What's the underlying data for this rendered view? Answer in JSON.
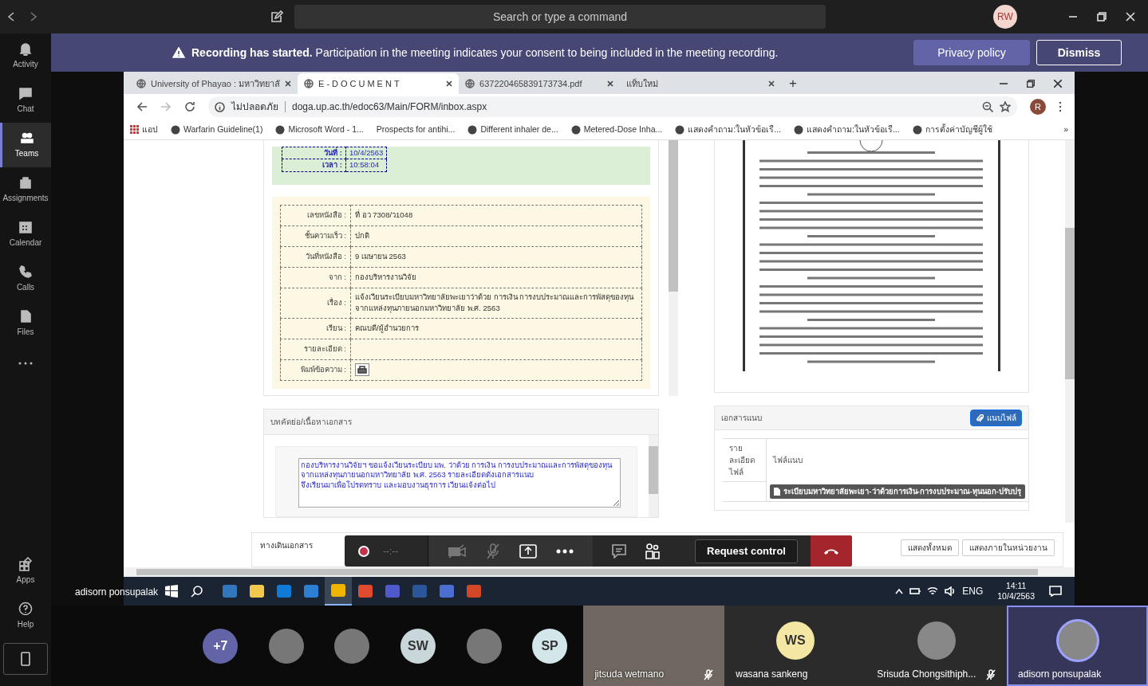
{
  "top_bar": {
    "search": {
      "placeholder": "Search or type a command"
    },
    "avatar": {
      "initials": "RW"
    }
  },
  "app_bar": {
    "items": [
      {
        "label": "Activity",
        "selected": false
      },
      {
        "label": "Chat",
        "selected": false
      },
      {
        "label": "Teams",
        "selected": true
      },
      {
        "label": "Assignments",
        "selected": false
      },
      {
        "label": "Calendar",
        "selected": false
      },
      {
        "label": "Calls",
        "selected": false
      },
      {
        "label": "Files",
        "selected": false
      }
    ],
    "bottom_items": [
      {
        "label": "Apps"
      },
      {
        "label": "Help"
      }
    ]
  },
  "banner": {
    "message": "**Recording has started.** Participation in the meeting indicates your consent to being included in the meeting recording.",
    "buttons": [
      "Privacy policy",
      "Dismiss"
    ]
  },
  "browser": {
    "tabs": [
      {
        "title": "University of Phayao : มหาวิทยาลั",
        "selected": false
      },
      {
        "title": "E-DOCUMENT",
        "selected": true
      },
      {
        "title": "637220465839173734.pdf",
        "selected": false
      },
      {
        "title": "แท็บใหม่",
        "selected": false
      }
    ],
    "new_tab": "+",
    "security": "ไม่ปลอดภัย",
    "url": "doga.up.ac.th/edoc63/Main/FORM/inbox.aspx",
    "profile": "R",
    "bookmarks": [
      "แอป",
      "Warfarin Guideline(1)",
      "Microsoft Word - 1...",
      "Prospects for antihi...",
      "Different inhaler de...",
      "Metered-Dose Inha...",
      "แสดงคำถาม:ในหัวข้อเรื...",
      "แสดงคำถาม:ในหัวข้อเรื...",
      "การตั้งค่าบัญชีผู้ใช้"
    ],
    "more_bookmarks": "»"
  },
  "page": {
    "receipt": [
      {
        "label": "วันที่ :",
        "value": "10/4/2563"
      },
      {
        "label": "เวลา :",
        "value": "10:58:04"
      }
    ],
    "details": [
      {
        "kind": "text",
        "label": "เลขหนังสือ :",
        "value": "ที่ อว 7308/ว1048"
      },
      {
        "kind": "text",
        "label": "ชั้นความเร็ว :",
        "value": "ปกติ"
      },
      {
        "kind": "text",
        "label": "วันที่หนังสือ :",
        "value": "9 เมษายน 2563"
      },
      {
        "kind": "text",
        "label": "จาก :",
        "value": "กองบริหารงานวิจัย"
      },
      {
        "kind": "text",
        "label": "เรื่อง :",
        "value": "แจ้งเวียนระเบียบมหาวิทยาลัยพะเยาว่าด้วย การเงิน การงบประมาณและการพัสดุของทุนจากแหล่งทุนภายนอกมหาวิทยาลัย พ.ศ. 2563"
      },
      {
        "kind": "text",
        "label": "เรียน :",
        "value": "คณบดี/ผู้อำนวยการ"
      },
      {
        "kind": "text",
        "label": "รายละเอียด :"
      },
      {
        "kind": "print",
        "label": "พิมพ์ข้อความ :"
      }
    ],
    "abstract": {
      "title": "บทคัดย่อ/เนื้อหาเอกสาร",
      "text": "กองบริหารงานวิจัยฯ ขอแจ้งเวียนระเบียบ มพ. ว่าด้วย การเงิน การงบประมาณและการพัสดุของทุนจากแหล่งทุนภายนอกมหาวิทยาลัย พ.ศ. 2563 รายละเอียดดังเอกสารแนบ\nจึงเรียนมาเพื่อโปรดทราบ และมอบงานธุรการ เวียนแจ้งต่อไป"
    },
    "attachments": {
      "title": "เอกสารแนบ",
      "button": "แนบไฟล์",
      "columns": [
        "รายละเอียดไฟล์",
        "ไฟล์แนบ"
      ],
      "rows": [
        {
          "file": "ระเบียบมหาวิทยาลัยพะเยา-ว่าด้วยการเงิน-การงบประมาณ-ทุนนอก-ปรับปรุ"
        }
      ]
    },
    "routing": {
      "title": "ทางเดินเอกสาร",
      "buttons": [
        "แสดงทั้งหมด",
        "แสดงภายในหน่วยงาน"
      ]
    }
  },
  "meeting_controls": {
    "timer": "--:--",
    "request_button": "Request control"
  },
  "presenter_label": "adisorn ponsupalak",
  "taskbar": {
    "apps": [
      {
        "selected": false
      },
      {
        "selected": false
      },
      {
        "selected": false
      },
      {
        "selected": false
      },
      {
        "selected": true
      },
      {
        "selected": false
      },
      {
        "selected": false
      },
      {
        "selected": false
      },
      {
        "selected": false
      },
      {
        "selected": false
      }
    ],
    "language": "ENG",
    "time": "14:11",
    "date": "10/4/2563"
  },
  "participants": [
    {
      "kind": "overflow",
      "label": "+7",
      "color": "#6264a7",
      "selected": false
    },
    {
      "kind": "photo",
      "selected": false
    },
    {
      "kind": "photo",
      "selected": false
    },
    {
      "kind": "initials",
      "initials": "SW",
      "color": "#c9d7db",
      "selected": false
    },
    {
      "kind": "photo",
      "selected": false
    },
    {
      "kind": "initials",
      "initials": "SP",
      "color": "#d3e7ea",
      "selected": false
    },
    {
      "kind": "video",
      "name": "jitsuda wetmano",
      "muted": true,
      "selected": false
    },
    {
      "kind": "tile",
      "initials": "WS",
      "color": "#f4e7a3",
      "name": "wasana sankeng",
      "muted": false,
      "selected": false
    },
    {
      "kind": "photo-tile",
      "name": "Srisuda Chongsithiph...",
      "muted": true,
      "selected": false
    },
    {
      "kind": "photo-tile",
      "name": "adisorn ponsupalak",
      "muted": false,
      "selected": true
    }
  ]
}
